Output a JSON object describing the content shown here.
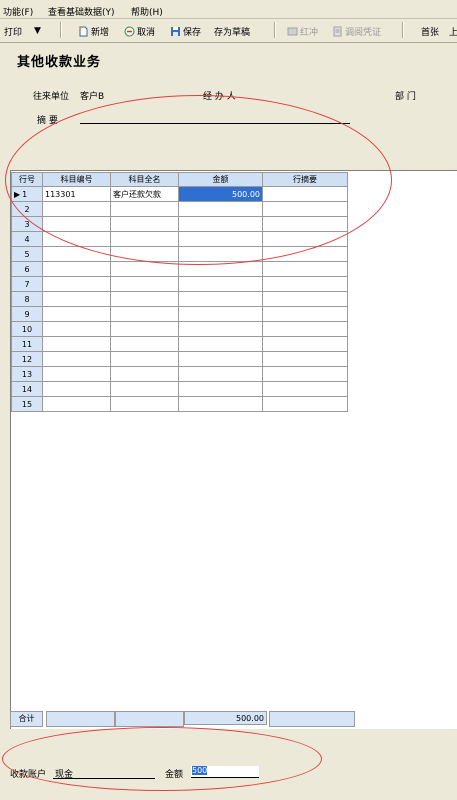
{
  "menubar": {
    "items": [
      "功能(F)",
      "查看基础数据(Y)",
      "帮助(H)"
    ]
  },
  "toolbar": {
    "print": "打印",
    "print_arrow": "▼",
    "new": "新增",
    "cancel": "取消",
    "save": "保存",
    "save_draft": "存为草稿",
    "red": "红冲",
    "voucher": "调阅凭证",
    "first": "首张",
    "prev": "上"
  },
  "form": {
    "title": "其他收款业务",
    "unit_label": "往来单位",
    "unit_value": "客户B",
    "handler_label": "经 办 人",
    "dept_label": "部    门",
    "summary_label": "摘    要",
    "summary_value": ""
  },
  "grid": {
    "headers": [
      "行号",
      "科目编号",
      "科目全名",
      "金额",
      "行摘要"
    ],
    "rows": [
      {
        "no": "1",
        "code": "113301",
        "name": "客户还款欠款",
        "amount": "500.00",
        "memo": ""
      },
      {
        "no": "2",
        "code": "",
        "name": "",
        "amount": "",
        "memo": ""
      },
      {
        "no": "3",
        "code": "",
        "name": "",
        "amount": "",
        "memo": ""
      },
      {
        "no": "4",
        "code": "",
        "name": "",
        "amount": "",
        "memo": ""
      },
      {
        "no": "5",
        "code": "",
        "name": "",
        "amount": "",
        "memo": ""
      },
      {
        "no": "6",
        "code": "",
        "name": "",
        "amount": "",
        "memo": ""
      },
      {
        "no": "7",
        "code": "",
        "name": "",
        "amount": "",
        "memo": ""
      },
      {
        "no": "8",
        "code": "",
        "name": "",
        "amount": "",
        "memo": ""
      },
      {
        "no": "9",
        "code": "",
        "name": "",
        "amount": "",
        "memo": ""
      },
      {
        "no": "10",
        "code": "",
        "name": "",
        "amount": "",
        "memo": ""
      },
      {
        "no": "11",
        "code": "",
        "name": "",
        "amount": "",
        "memo": ""
      },
      {
        "no": "12",
        "code": "",
        "name": "",
        "amount": "",
        "memo": ""
      },
      {
        "no": "13",
        "code": "",
        "name": "",
        "amount": "",
        "memo": ""
      },
      {
        "no": "14",
        "code": "",
        "name": "",
        "amount": "",
        "memo": ""
      },
      {
        "no": "15",
        "code": "",
        "name": "",
        "amount": "",
        "memo": ""
      }
    ],
    "total_label": "合计",
    "total_amount": "500.00"
  },
  "footer": {
    "account_label": "收款账户",
    "account_value": "现金",
    "amount_label": "金额",
    "amount_value": "500"
  },
  "colors": {
    "annotation": "#e04040",
    "selection": "#2f6fd1",
    "header_bg": "#cfe0f5"
  }
}
